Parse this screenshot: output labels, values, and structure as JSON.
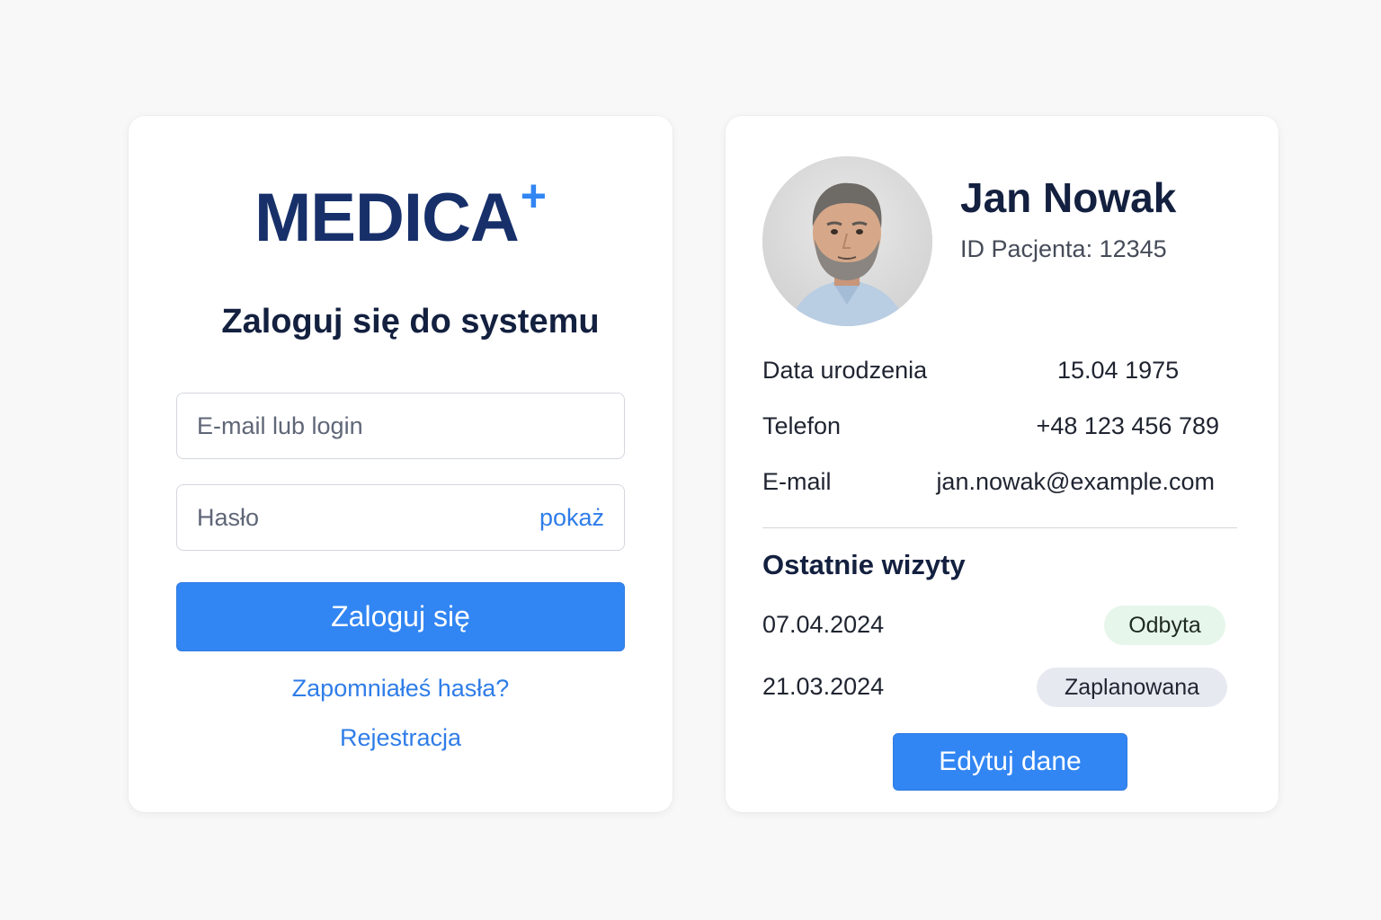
{
  "login": {
    "logo_text": "MEDICA",
    "logo_plus": "+",
    "title": "Zaloguj się do systemu",
    "email_placeholder": "E-mail lub login",
    "password_placeholder": "Hasło",
    "show_password_label": "pokaż",
    "submit_label": "Zaloguj się",
    "forgot_password_label": "Zapomniałeś hasła?",
    "register_label": "Rejestracja"
  },
  "profile": {
    "avatar_icon": "patient-photo",
    "name": "Jan Nowak",
    "patient_id": "ID Pacjenta: 12345",
    "info": [
      {
        "label": "Data urodzenia",
        "value": "15.04 1975"
      },
      {
        "label": "Telefon",
        "value": "+48 123 456 789"
      },
      {
        "label": "E-mail",
        "value": "jan.nowak@example.com"
      }
    ],
    "visits_title": "Ostatnie wizyty",
    "visits": [
      {
        "date": "07.04.2024",
        "status": "Odbyta"
      },
      {
        "date": "21.03.2024",
        "status": "Zaplanowana"
      }
    ],
    "edit_label": "Edytuj dane"
  },
  "colors": {
    "accent": "#3286f3",
    "brand": "#17306a",
    "status_done_bg": "#e6f6ea",
    "status_planned_bg": "#e7e9f1"
  }
}
